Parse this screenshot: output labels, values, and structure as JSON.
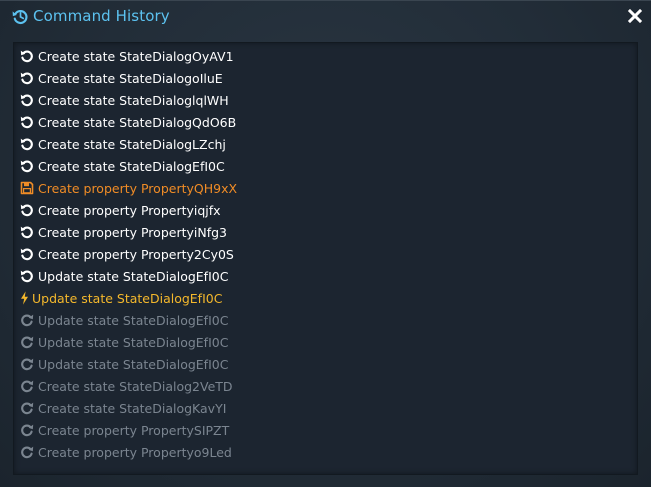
{
  "window": {
    "title": "Command History",
    "title_icon": "history-icon",
    "close_icon": "close-icon"
  },
  "colors": {
    "title": "#5cc2f0",
    "done": "#ffffff",
    "saved": "#f08c26",
    "current": "#f4b82c",
    "redo": "#7b8590",
    "background": "#1c2530"
  },
  "history": {
    "items": [
      {
        "label": "Create state StateDialogOyAV1",
        "status": "done",
        "icon": "undo-icon"
      },
      {
        "label": "Create state StateDialogoIluE",
        "status": "done",
        "icon": "undo-icon"
      },
      {
        "label": "Create state StateDialoglqlWH",
        "status": "done",
        "icon": "undo-icon"
      },
      {
        "label": "Create state StateDialogQdO6B",
        "status": "done",
        "icon": "undo-icon"
      },
      {
        "label": "Create state StateDialogLZchj",
        "status": "done",
        "icon": "undo-icon"
      },
      {
        "label": "Create state StateDialogEfI0C",
        "status": "done",
        "icon": "undo-icon"
      },
      {
        "label": "Create property PropertyQH9xX",
        "status": "saved",
        "icon": "save-icon"
      },
      {
        "label": "Create property Propertyiqjfx",
        "status": "done",
        "icon": "undo-icon"
      },
      {
        "label": "Create property PropertyiNfg3",
        "status": "done",
        "icon": "undo-icon"
      },
      {
        "label": "Create property Property2Cy0S",
        "status": "done",
        "icon": "undo-icon"
      },
      {
        "label": "Update state StateDialogEfI0C",
        "status": "done",
        "icon": "undo-icon"
      },
      {
        "label": "Update state StateDialogEfI0C",
        "status": "current",
        "icon": "lightning-icon"
      },
      {
        "label": "Update state StateDialogEfI0C",
        "status": "redo",
        "icon": "redo-icon"
      },
      {
        "label": "Update state StateDialogEfI0C",
        "status": "redo",
        "icon": "redo-icon"
      },
      {
        "label": "Update state StateDialogEfI0C",
        "status": "redo",
        "icon": "redo-icon"
      },
      {
        "label": "Create state StateDialog2VeTD",
        "status": "redo",
        "icon": "redo-icon"
      },
      {
        "label": "Create state StateDialogKavYI",
        "status": "redo",
        "icon": "redo-icon"
      },
      {
        "label": "Create property PropertySIPZT",
        "status": "redo",
        "icon": "redo-icon"
      },
      {
        "label": "Create property Propertyo9Led",
        "status": "redo",
        "icon": "redo-icon"
      }
    ]
  }
}
